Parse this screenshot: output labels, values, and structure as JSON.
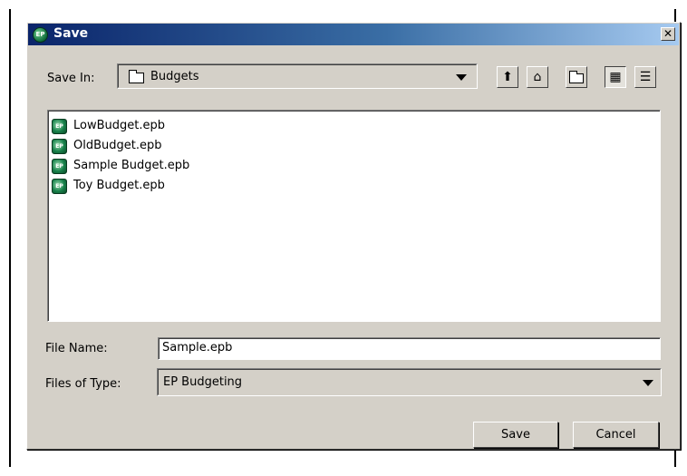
{
  "window": {
    "title": "Save",
    "close_glyph": "✕",
    "app_icon_text": "EP"
  },
  "toolbar": {
    "save_in_label": "Save In:",
    "current_folder": "Budgets",
    "buttons": [
      {
        "name": "up-one-level-icon",
        "glyph": "⬆"
      },
      {
        "name": "home-icon",
        "glyph": "⌂"
      },
      {
        "name": "new-folder-icon",
        "glyph": ""
      },
      {
        "name": "list-view-icon",
        "glyph": "▦",
        "pressed": true
      },
      {
        "name": "details-view-icon",
        "glyph": "☰"
      }
    ]
  },
  "files": [
    {
      "name": "LowBudget.epb"
    },
    {
      "name": "OldBudget.epb"
    },
    {
      "name": "Sample Budget.epb"
    },
    {
      "name": "Toy Budget.epb"
    }
  ],
  "form": {
    "file_name_label": "File Name:",
    "file_name_value": "Sample.epb",
    "file_type_label": "Files of Type:",
    "file_type_value": "EP Budgeting"
  },
  "buttons": {
    "save": "Save",
    "cancel": "Cancel"
  },
  "colors": {
    "titlebar_start": "#0a246a",
    "titlebar_end": "#a6caf0",
    "dialog_bg": "#d4d0c8",
    "file_icon": "#17804a"
  }
}
